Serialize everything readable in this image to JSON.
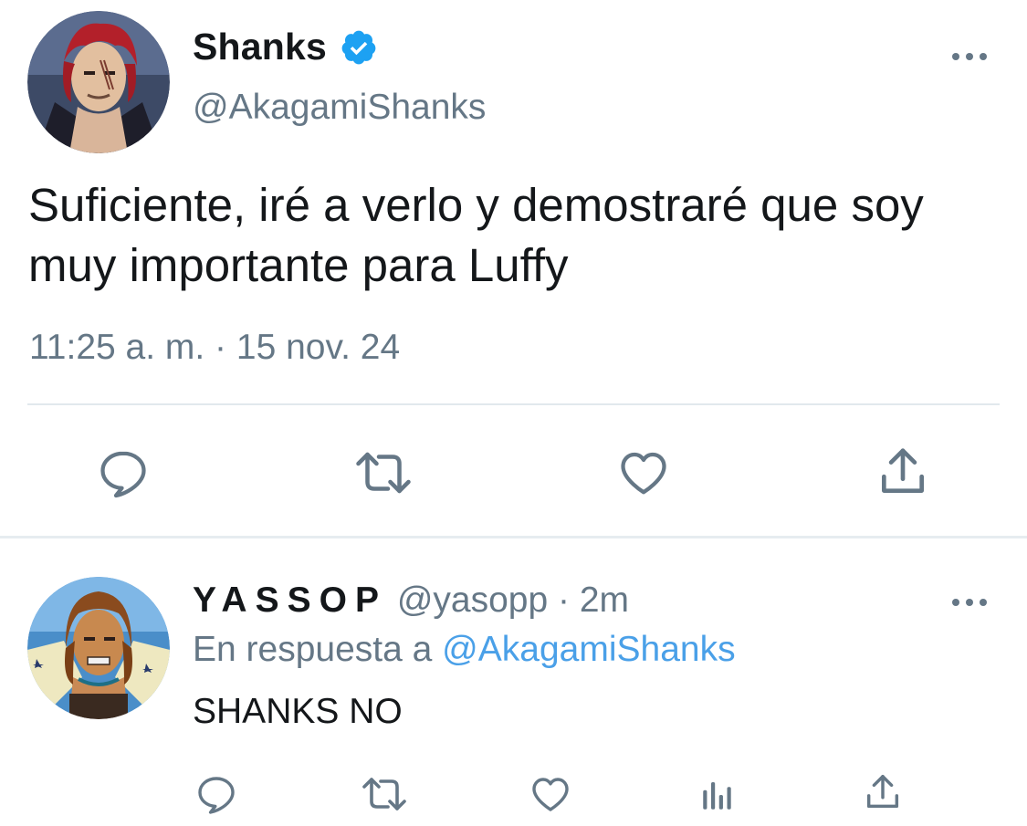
{
  "main_tweet": {
    "display_name": "Shanks",
    "handle": "@AkagamiShanks",
    "text": "Suficiente, iré a verlo y demostraré que soy muy importante para Luffy",
    "time": "11:25 a. m. · 15 nov. 24",
    "verified": true,
    "icons": [
      "more-icon",
      "reply-icon",
      "retweet-icon",
      "like-icon",
      "share-icon"
    ]
  },
  "reply_tweet": {
    "display_name": "YASSOP",
    "handle_time": " @yasopp · 2m",
    "context_prefix": "En respuesta a ",
    "context_mention": "@AkagamiShanks",
    "text": "SHANKS NO",
    "icons": [
      "more-icon",
      "reply-icon",
      "retweet-icon",
      "like-icon",
      "stats-icon",
      "share-icon"
    ]
  },
  "colors": {
    "text": "#14171a",
    "secondary": "#657786",
    "link": "#4aa0e8",
    "verified": "#1da1f2",
    "divider": "#e1e8ed"
  }
}
